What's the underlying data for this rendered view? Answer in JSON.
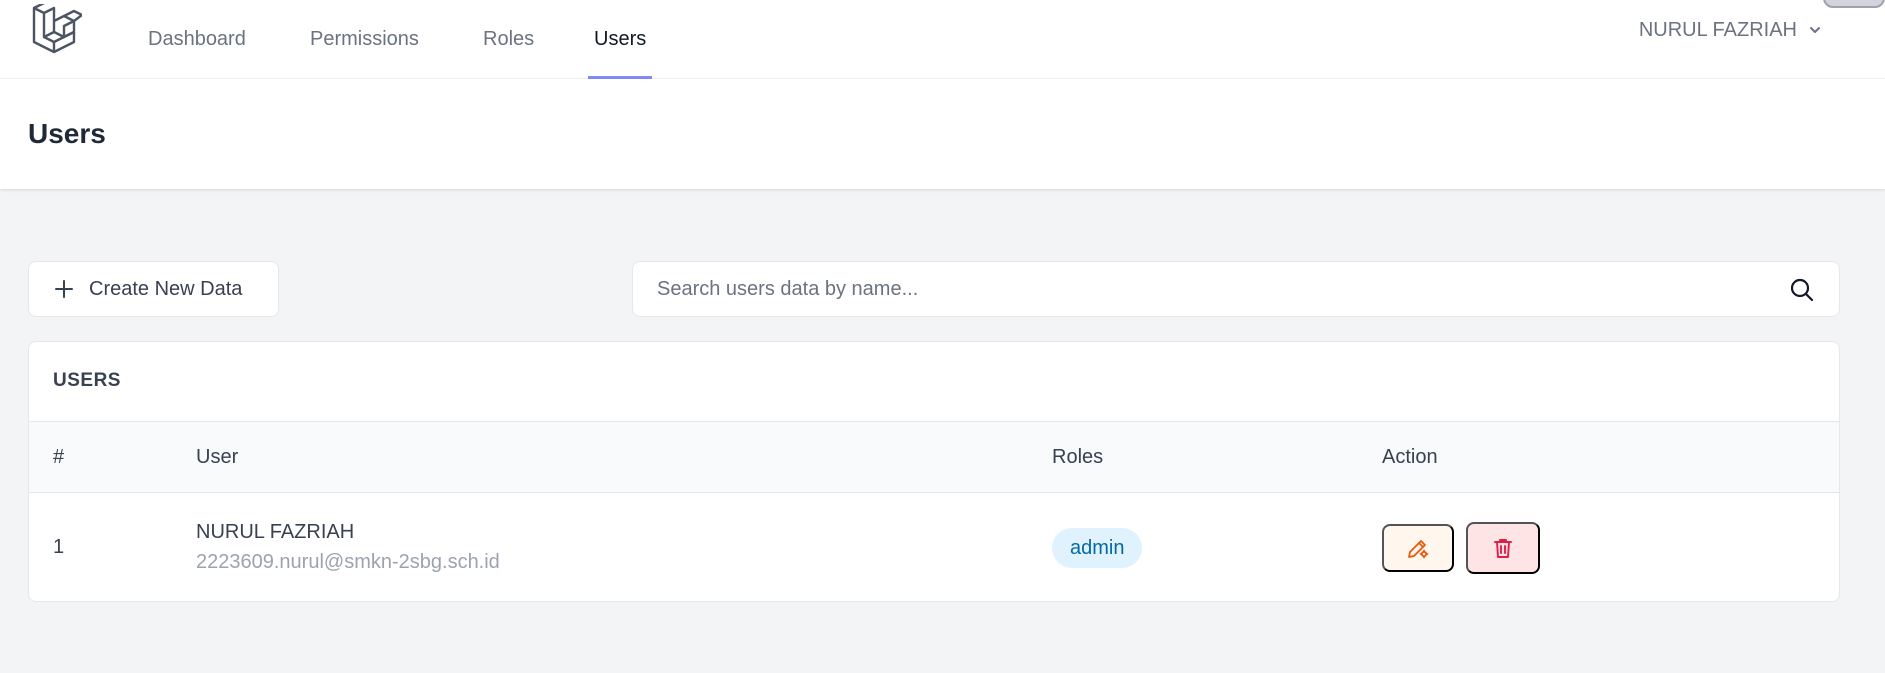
{
  "nav": {
    "links": [
      {
        "label": "Dashboard"
      },
      {
        "label": "Permissions"
      },
      {
        "label": "Roles"
      },
      {
        "label": "Users"
      }
    ],
    "active": "Users",
    "user_name": "NURUL FAZRIAH"
  },
  "page": {
    "title": "Users"
  },
  "toolbar": {
    "create_label": "Create New Data",
    "search_placeholder": "Search users data by name..."
  },
  "table": {
    "title": "USERS",
    "headers": [
      "#",
      "User",
      "Roles",
      "Action"
    ],
    "rows": [
      {
        "num": "1",
        "name": "NURUL FAZRIAH",
        "email": "2223609.nurul@smkn-2sbg.sch.id",
        "role": "admin"
      }
    ]
  },
  "colors": {
    "accent": "#818cf8",
    "edit_bg": "#fff7ed",
    "edit_icon": "#ea580c",
    "delete_bg": "#ffe4e6",
    "delete_icon": "#e11d48",
    "badge_bg": "#e0f2fe",
    "badge_text": "#0369a1"
  },
  "icons": {
    "logo": "laravel-logo-icon",
    "user_menu": "chevron-down-icon",
    "create": "plus-icon",
    "search": "search-icon",
    "edit": "pencil-gear-icon",
    "delete": "trash-icon"
  }
}
